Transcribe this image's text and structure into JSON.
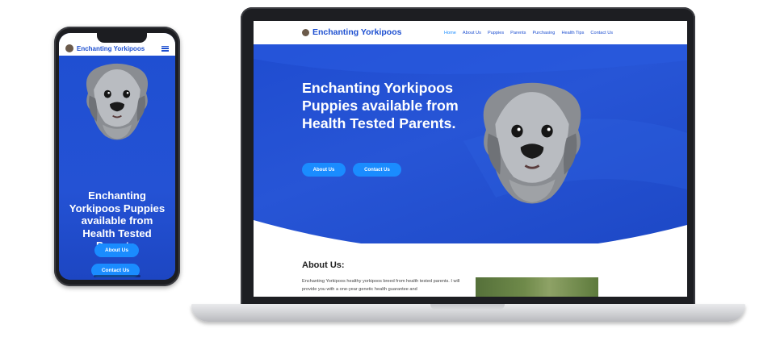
{
  "site": {
    "brand": "Enchanting Yorkipoos",
    "nav": [
      "Home",
      "About Us",
      "Puppies",
      "Parents",
      "Purchasing",
      "Health Tips",
      "Contact Us"
    ],
    "active_nav": "Home",
    "hero_headline": "Enchanting Yorkipoos Puppies available from Health Tested Parents.",
    "hero_buttons": {
      "about": "About Us",
      "contact": "Contact Us"
    },
    "about": {
      "title": "About Us:",
      "text": "Enchanting Yorkipoos healthy yorkipoos breed from health tested parents. I will provide you with a one-year genetic health guarantee and"
    }
  },
  "phone": {
    "brand": "Enchanting Yorkipoos",
    "hero_headline": "Enchanting Yorkipoos Puppies available from Health Tested Parents.",
    "buttons": {
      "about": "About Us",
      "contact": "Contact Us"
    }
  },
  "icons": {
    "logo": "dog-logo-icon",
    "menu": "hamburger-menu-icon"
  },
  "colors": {
    "primary_blue": "#1d4fd0",
    "button_blue": "#1a8cff",
    "device_dark": "#1c1d21"
  }
}
